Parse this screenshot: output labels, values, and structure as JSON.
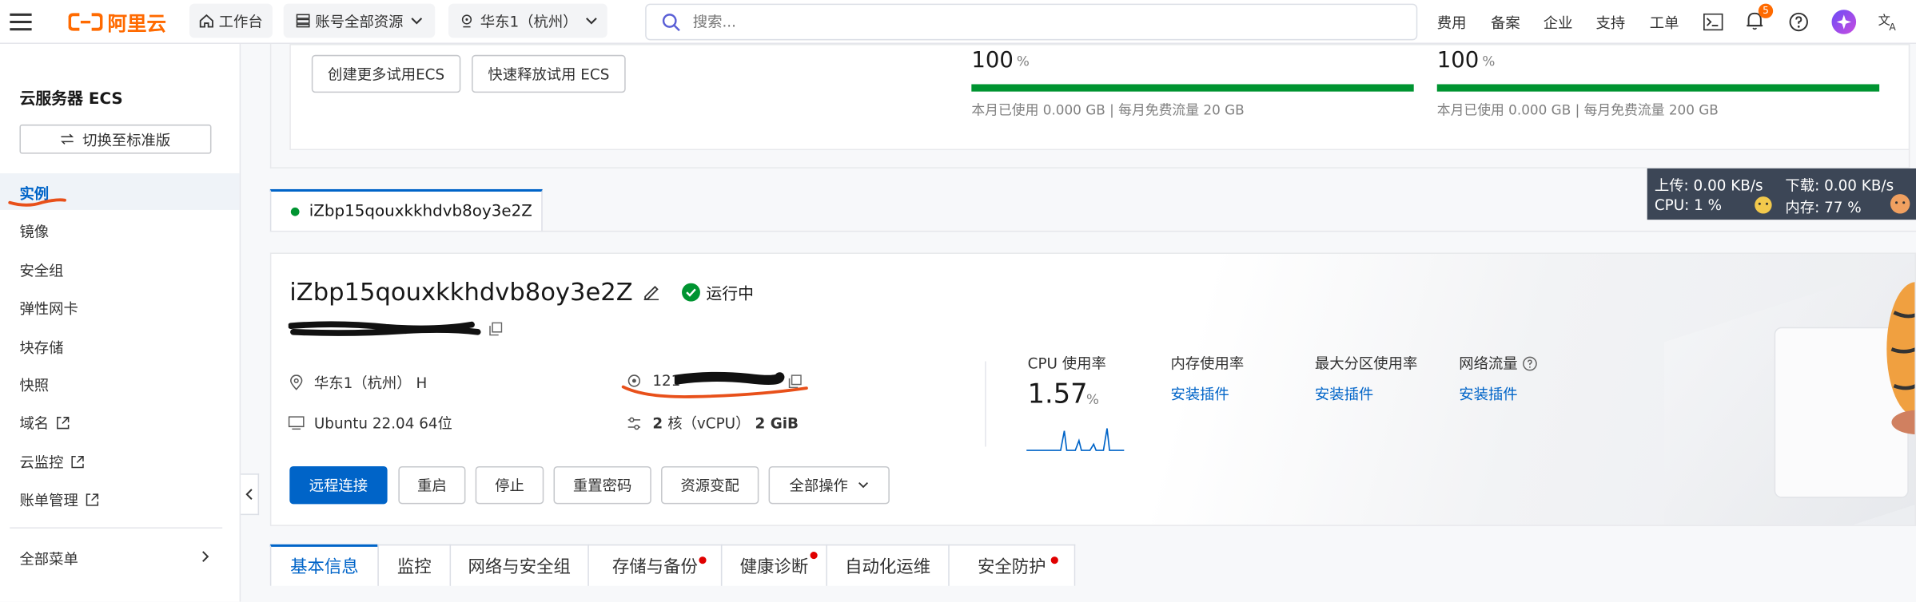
{
  "topbar": {
    "logo_text": "阿里云",
    "workbench": "工作台",
    "resource_scope": "账号全部资源",
    "region": "华东1（杭州）",
    "search_placeholder": "搜索...",
    "links": [
      "费用",
      "备案",
      "企业",
      "支持",
      "工单"
    ],
    "notification_count": "5"
  },
  "sidebar": {
    "title": "云服务器 ECS",
    "switch_button": "切换至标准版",
    "items": [
      {
        "label": "实例",
        "active": true
      },
      {
        "label": "镜像"
      },
      {
        "label": "安全组"
      },
      {
        "label": "弹性网卡"
      },
      {
        "label": "块存储"
      },
      {
        "label": "快照"
      },
      {
        "label": "域名",
        "external": true
      },
      {
        "label": "云监控",
        "external": true
      },
      {
        "label": "账单管理",
        "external": true
      }
    ],
    "all_menu": "全部菜单"
  },
  "trial": {
    "create_more": "创建更多试用ECS",
    "quick_release": "快速释放试用 ECS",
    "usage": [
      {
        "percent": "100",
        "unit": "%",
        "note": "本月已使用 0.000 GB | 每月免费流量 20 GB",
        "fill": 1.0
      },
      {
        "percent": "100",
        "unit": "%",
        "note": "本月已使用 0.000 GB | 每月免费流量 200 GB",
        "fill": 1.0
      }
    ]
  },
  "net_monitor": {
    "upload": "上传: 0.00 KB/s",
    "download": "下载: 0.00 KB/s",
    "cpu": "CPU: 1 %",
    "memory": "内存: 77 %"
  },
  "instance_tab": "iZbp15qouxkkhdvb8oy3e2Z",
  "instance": {
    "name": "iZbp15qouxkkhdvb8oy3e2Z",
    "status": "运行中",
    "region": "华东1（杭州） H",
    "ip_visible": "121",
    "os": "Ubuntu 22.04 64位",
    "spec_cores": "2",
    "spec_core_unit": "核（vCPU）",
    "spec_mem": "2 GiB"
  },
  "metrics": {
    "cpu_label": "CPU 使用率",
    "cpu_value": "1.57",
    "cpu_unit": "%",
    "mem_label": "内存使用率",
    "mem_action": "安装插件",
    "disk_label": "最大分区使用率",
    "disk_action": "安装插件",
    "net_label": "网络流量",
    "net_action": "安装插件"
  },
  "actions": {
    "remote": "远程连接",
    "restart": "重启",
    "stop": "停止",
    "reset_pwd": "重置密码",
    "resize": "资源变配",
    "all_ops": "全部操作"
  },
  "tabs": [
    {
      "label": "基本信息",
      "active": true,
      "dot": false
    },
    {
      "label": "监控",
      "dot": false
    },
    {
      "label": "网络与安全组",
      "dot": false
    },
    {
      "label": "存储与备份",
      "dot": true
    },
    {
      "label": "健康诊断",
      "dot": true
    },
    {
      "label": "自动化运维",
      "dot": false
    },
    {
      "label": "安全防护",
      "dot": true
    }
  ],
  "colors": {
    "brand": "#ff6a00",
    "primary": "#0064c8",
    "success": "#009431",
    "annotation": "#e8501a"
  }
}
